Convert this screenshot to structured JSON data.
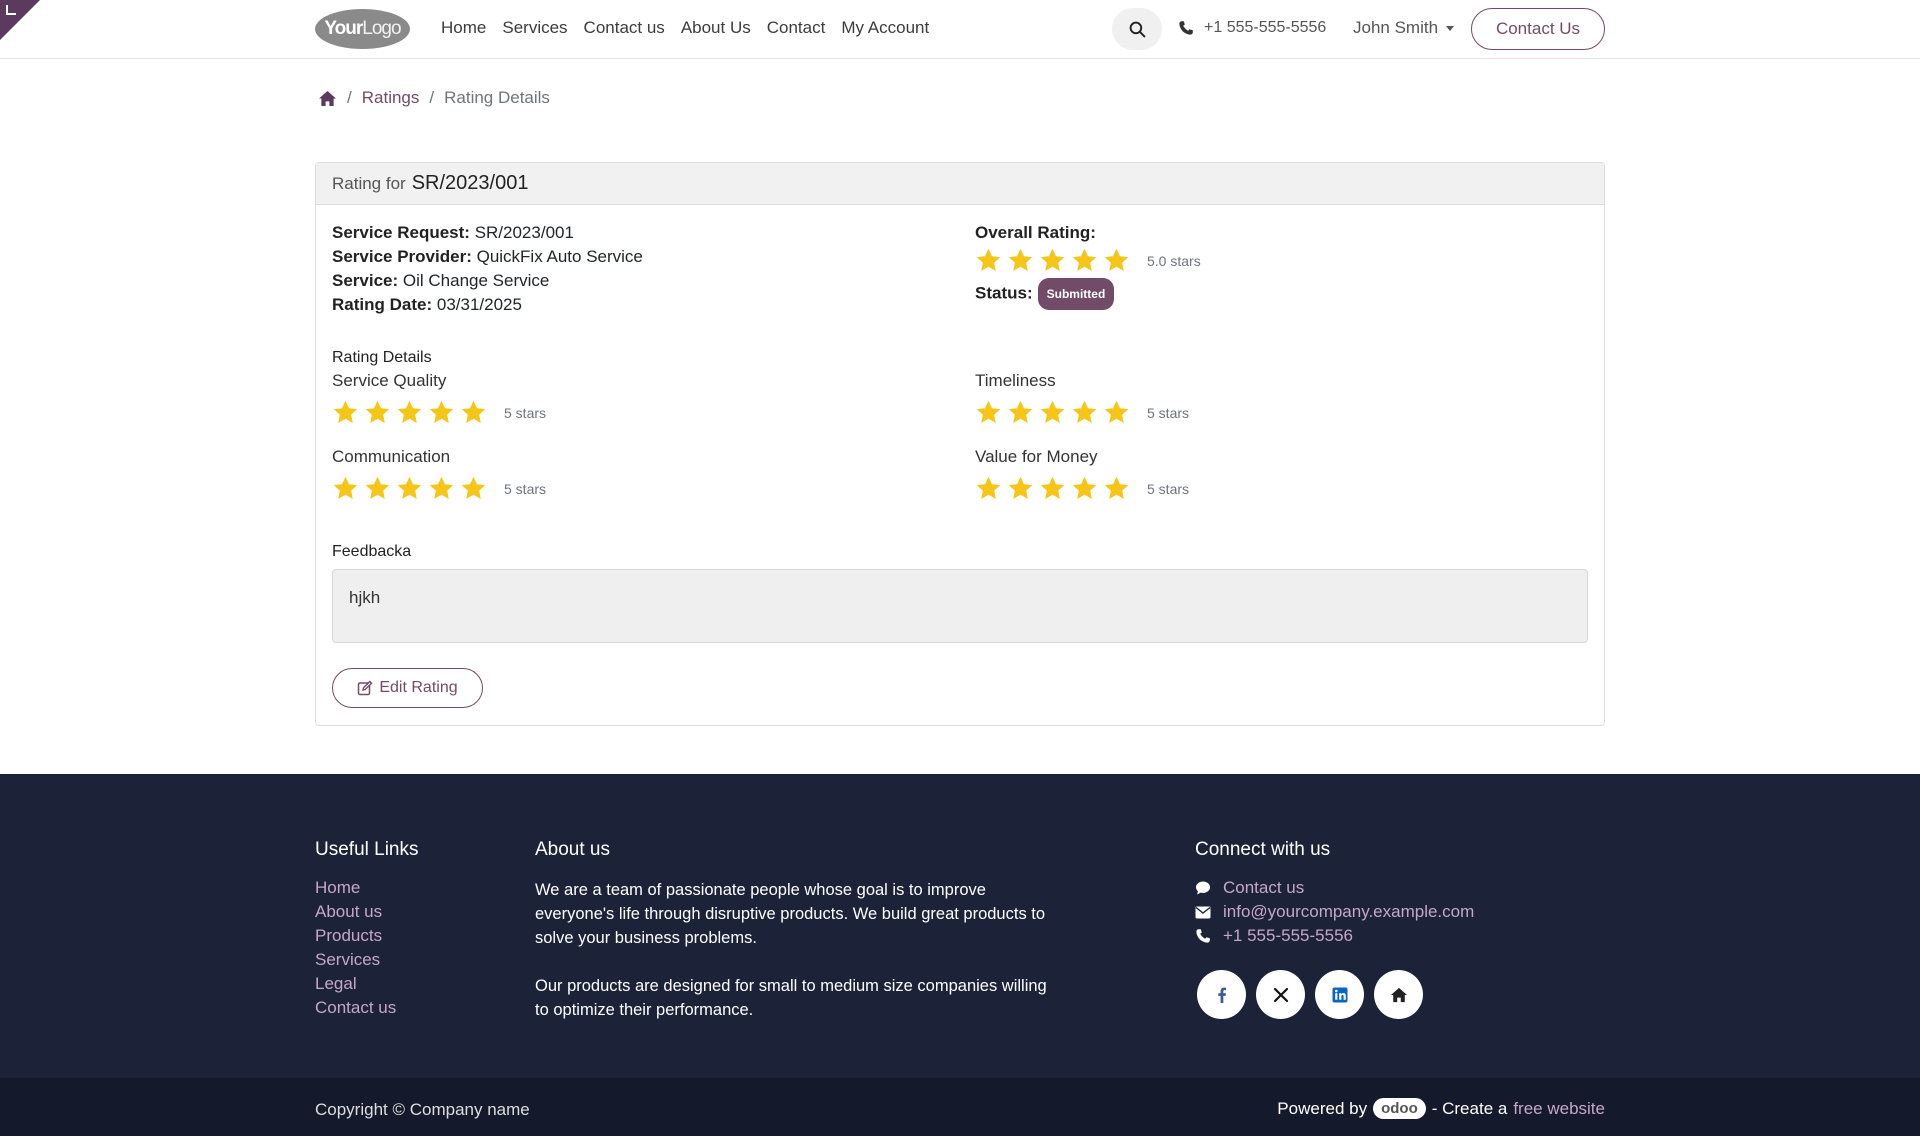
{
  "header": {
    "logo": {
      "part1": "Your",
      "part2": "Logo"
    },
    "nav": [
      "Home",
      "Services",
      "Contact us",
      "About Us",
      "Contact",
      "My Account"
    ],
    "phone": "+1 555-555-5556",
    "user": "John Smith",
    "contact_button": "Contact Us"
  },
  "breadcrumb": {
    "items": [
      "Ratings",
      "Rating Details"
    ]
  },
  "card": {
    "title_prefix": "Rating for",
    "title_ref": "SR/2023/001",
    "fields": {
      "service_request": {
        "label": "Service Request:",
        "value": "SR/2023/001"
      },
      "service_provider": {
        "label": "Service Provider:",
        "value": "QuickFix Auto Service"
      },
      "service": {
        "label": "Service:",
        "value": "Oil Change Service"
      },
      "rating_date": {
        "label": "Rating Date:",
        "value": "03/31/2025"
      }
    },
    "overall": {
      "label": "Overall Rating:",
      "stars": 5,
      "note": "5.0 stars"
    },
    "status": {
      "label": "Status:",
      "value": "Submitted"
    },
    "details_title": "Rating Details",
    "ratings": [
      {
        "label": "Service Quality",
        "stars": 5,
        "note": "5 stars"
      },
      {
        "label": "Timeliness",
        "stars": 5,
        "note": "5 stars"
      },
      {
        "label": "Communication",
        "stars": 5,
        "note": "5 stars"
      },
      {
        "label": "Value for Money",
        "stars": 5,
        "note": "5 stars"
      }
    ],
    "feedback_title": "Feedbacka",
    "feedback_text": "hjkh",
    "edit_button": "Edit Rating"
  },
  "footer": {
    "useful_links_title": "Useful Links",
    "useful_links": [
      "Home",
      "About us",
      "Products",
      "Services",
      "Legal",
      "Contact us"
    ],
    "about_title": "About us",
    "about_p1": "We are a team of passionate people whose goal is to improve everyone's life through disruptive products. We build great products to solve your business problems.",
    "about_p2": "Our products are designed for small to medium size companies willing to optimize their performance.",
    "connect_title": "Connect with us",
    "connect": {
      "contact": "Contact us",
      "email": "info@yourcompany.example.com",
      "phone": "+1 555-555-5556"
    },
    "copyright": "Copyright © Company name",
    "powered_by": "Powered by",
    "odoo": "odoo",
    "create": "- Create a",
    "free_website": "free website"
  },
  "colors": {
    "accent": "#714b67",
    "star": "#f5c518",
    "footer_bg": "#1c2237"
  }
}
